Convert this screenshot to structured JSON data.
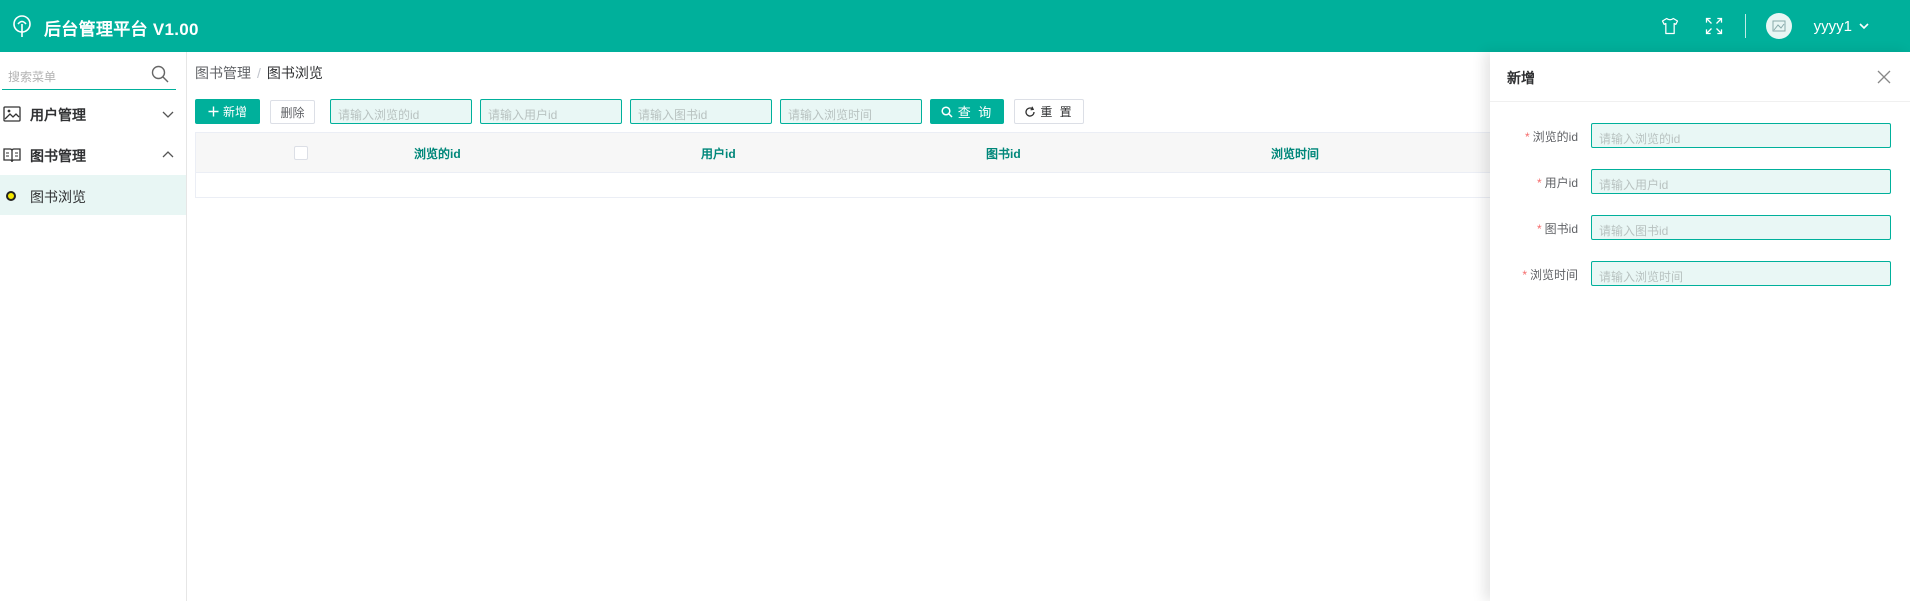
{
  "header": {
    "title": "后台管理平台 V1.00",
    "username": "yyyy1",
    "bg_color": "#00b09b",
    "icons": [
      "logo-icon",
      "tshirt-icon",
      "fullscreen-icon",
      "avatar",
      "chevron-down-icon"
    ]
  },
  "sidebar": {
    "search_placeholder": "搜索菜单",
    "menus": [
      {
        "label": "用户管理",
        "icon": "image-icon",
        "expanded": false
      },
      {
        "label": "图书管理",
        "icon": "book-icon",
        "expanded": true,
        "children": [
          {
            "label": "图书浏览",
            "active": true
          }
        ]
      }
    ]
  },
  "breadcrumb": {
    "parent": "图书管理",
    "separator": "/",
    "current": "图书浏览"
  },
  "toolbar": {
    "add_label": "新增",
    "delete_label": "删除",
    "filters": [
      {
        "placeholder": "请输入浏览的id"
      },
      {
        "placeholder": "请输入用户id"
      },
      {
        "placeholder": "请输入图书id"
      },
      {
        "placeholder": "请输入浏览时间"
      }
    ],
    "query_label": "查 询",
    "reset_label": "重 置"
  },
  "table": {
    "columns": [
      "浏览的id",
      "用户id",
      "图书id",
      "浏览时间"
    ],
    "rows": []
  },
  "drawer": {
    "title": "新增",
    "fields": [
      {
        "label": "浏览的id",
        "placeholder": "请输入浏览的id",
        "required": true
      },
      {
        "label": "用户id",
        "placeholder": "请输入用户id",
        "required": true
      },
      {
        "label": "图书id",
        "placeholder": "请输入图书id",
        "required": true
      },
      {
        "label": "浏览时间",
        "placeholder": "请输入浏览时间",
        "required": true
      }
    ]
  },
  "colors": {
    "accent": "#00b09b",
    "required": "#f56c6c",
    "active_bg": "#e8f6f4"
  }
}
